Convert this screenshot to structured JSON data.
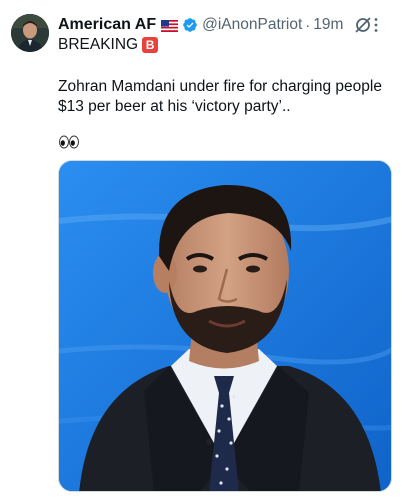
{
  "tweet": {
    "display_name": "American AF",
    "handle": "@iAnonPatriot",
    "separator": "·",
    "time": "19m",
    "line1": "BREAKING",
    "line1_emoji": "B",
    "body": "Zohran Mamdani under fire for charging people $13 per beer at his ‘victory party’..",
    "icons": {
      "flag": "us-flag-icon",
      "verified": "verified-badge-icon",
      "grok": "grok-icon",
      "more": "more-options-icon",
      "eyes": "eyes-emoji-icon"
    },
    "colors": {
      "verified": "#1d9bf0",
      "secondary_text": "#536471",
      "badge_b": "#e8423c",
      "media_bg": "#1d7fe0"
    }
  }
}
